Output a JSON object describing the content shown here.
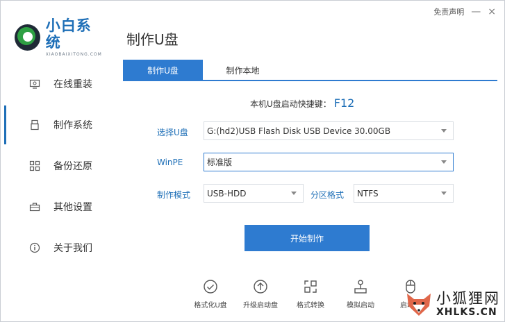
{
  "app": {
    "logo_title": "小白系统",
    "logo_subtitle": "XIAOBAIXITONG.COM",
    "page_title": "制作U盘",
    "disclaimer": "免责声明",
    "minimize_glyph": "—",
    "close_glyph": "×"
  },
  "sidebar": {
    "items": [
      {
        "label": "在线重装",
        "icon": "monitor-icon"
      },
      {
        "label": "制作系统",
        "icon": "usb-drive-icon",
        "active": true
      },
      {
        "label": "备份还原",
        "icon": "grid-icon"
      },
      {
        "label": "其他设置",
        "icon": "toolbox-icon"
      },
      {
        "label": "关于我们",
        "icon": "info-icon"
      }
    ]
  },
  "tabs": [
    {
      "label": "制作U盘",
      "active": true
    },
    {
      "label": "制作本地"
    }
  ],
  "hotkey": {
    "label": "本机U盘启动快捷键：",
    "key": "F12"
  },
  "form": {
    "usb_label": "选择U盘",
    "usb_value": "G:(hd2)USB Flash Disk USB Device 30.00GB",
    "winpe_label": "WinPE",
    "winpe_value": "标准版",
    "mode_label": "制作模式",
    "mode_value": "USB-HDD",
    "partition_label": "分区格式",
    "partition_value": "NTFS"
  },
  "start_button": "开始制作",
  "tools": [
    {
      "label": "格式化U盘",
      "icon": "check-circle-icon"
    },
    {
      "label": "升级启动盘",
      "icon": "upload-circle-icon"
    },
    {
      "label": "格式转换",
      "icon": "convert-icon"
    },
    {
      "label": "模拟启动",
      "icon": "joystick-icon"
    },
    {
      "label": "启动快",
      "icon": "mouse-icon"
    }
  ],
  "watermark": {
    "cn": "小狐狸网",
    "en": "XHLKS.CN"
  },
  "colors": {
    "accent": "#2e7bd0",
    "brand": "#1e6fb7"
  }
}
